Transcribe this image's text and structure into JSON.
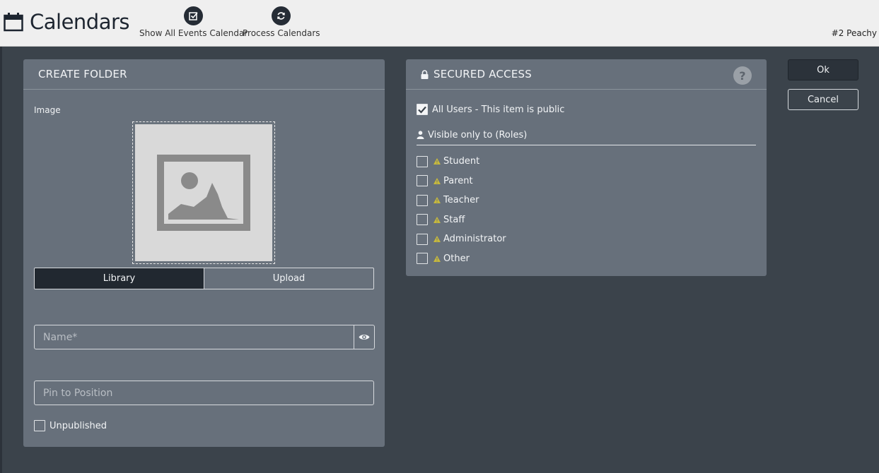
{
  "header": {
    "title": "Calendars",
    "title_icon": "calendar-icon",
    "tools": [
      {
        "label": "Show All Events Calendar",
        "icon": "check-square-icon"
      },
      {
        "label": "Process Calendars",
        "icon": "refresh-icon"
      }
    ],
    "site_name": "#2 Peachy"
  },
  "create_folder": {
    "title": "CREATE FOLDER",
    "image_label": "Image",
    "tabs": [
      {
        "label": "Library",
        "active": true
      },
      {
        "label": "Upload",
        "active": false
      }
    ],
    "name_placeholder": "Name*",
    "pin_placeholder": "Pin to Position",
    "unpublished_label": "Unpublished",
    "unpublished_checked": false
  },
  "secured_access": {
    "title": "SECURED ACCESS",
    "help_symbol": "?",
    "all_users_label": "All Users - This item is public",
    "all_users_checked": true,
    "roles_heading": "Visible only to (Roles)",
    "roles": [
      {
        "label": "Student",
        "checked": false
      },
      {
        "label": "Parent",
        "checked": false
      },
      {
        "label": "Teacher",
        "checked": false
      },
      {
        "label": "Staff",
        "checked": false
      },
      {
        "label": "Administrator",
        "checked": false
      },
      {
        "label": "Other",
        "checked": false
      }
    ]
  },
  "actions": {
    "ok_label": "Ok",
    "cancel_label": "Cancel"
  },
  "colors": {
    "panel_bg": "#67707b",
    "page_bg": "#3b434b",
    "active_tab": "#212830",
    "warning": "#c7b93c"
  }
}
